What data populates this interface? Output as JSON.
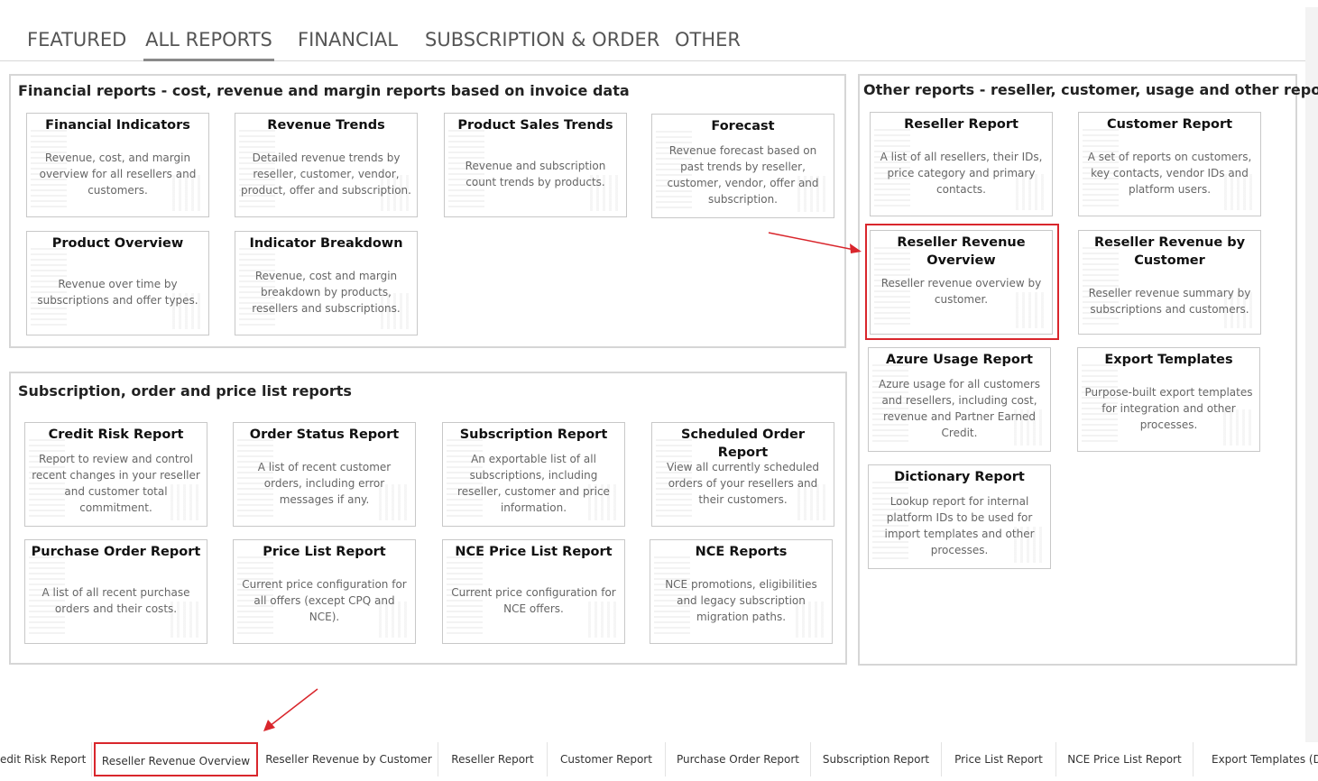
{
  "tabs": [
    {
      "label": "FEATURED"
    },
    {
      "label": "ALL REPORTS"
    },
    {
      "label": "FINANCIAL"
    },
    {
      "label": "SUBSCRIPTION & ORDER"
    },
    {
      "label": "OTHER"
    }
  ],
  "sections": {
    "financial": {
      "title": "Financial reports - cost, revenue and margin reports based on invoice data",
      "cards": [
        {
          "title": "Financial Indicators",
          "desc": "Revenue, cost, and margin overview for all resellers and customers."
        },
        {
          "title": "Revenue Trends",
          "desc": "Detailed revenue trends by reseller, customer, vendor, product, offer and subscription."
        },
        {
          "title": "Product Sales Trends",
          "desc": "Revenue and subscription count trends by products."
        },
        {
          "title": "Forecast",
          "desc": "Revenue forecast based on past trends by reseller, customer, vendor, offer and subscription."
        },
        {
          "title": "Product Overview",
          "desc": "Revenue over time by subscriptions and offer types."
        },
        {
          "title": "Indicator Breakdown",
          "desc": "Revenue, cost and margin breakdown by products, resellers and subscriptions."
        }
      ]
    },
    "subscription": {
      "title": "Subscription, order and price list reports",
      "cards": [
        {
          "title": "Credit Risk Report",
          "desc": "Report to review and control recent changes in your reseller and customer total commitment."
        },
        {
          "title": "Order Status Report",
          "desc": "A list of recent customer orders, including error messages if any."
        },
        {
          "title": "Subscription Report",
          "desc": "An exportable list of all subscriptions, including reseller, customer and price information."
        },
        {
          "title": "Scheduled Order Report",
          "desc": "View all currently scheduled orders of your resellers and their customers."
        },
        {
          "title": "Purchase Order Report",
          "desc": "A list of all recent purchase orders and their costs."
        },
        {
          "title": "Price List Report",
          "desc": "Current price configuration for all offers (except CPQ and NCE)."
        },
        {
          "title": "NCE Price List Report",
          "desc": "Current price configuration for NCE offers."
        },
        {
          "title": "NCE Reports",
          "desc": "NCE promotions, eligibilities and legacy subscription migration paths."
        }
      ]
    },
    "other": {
      "title": "Other reports - reseller, customer, usage and other reports",
      "cards": [
        {
          "title": "Reseller Report",
          "desc": "A list of all resellers, their IDs, price category and primary contacts."
        },
        {
          "title": "Customer Report",
          "desc": "A set of reports on customers, key contacts, vendor IDs and platform users."
        },
        {
          "title": "Reseller Revenue Overview",
          "desc": "Reseller revenue overview by customer."
        },
        {
          "title": "Reseller Revenue by Customer",
          "desc": "Reseller revenue summary by subscriptions and customers."
        },
        {
          "title": "Azure Usage Report",
          "desc": "Azure usage for all customers and resellers, including cost, revenue and Partner Earned Credit."
        },
        {
          "title": "Export Templates",
          "desc": "Purpose-built export templates for integration and other processes."
        },
        {
          "title": "Dictionary Report",
          "desc": "Lookup report for internal platform IDs to be used for import templates and other processes."
        }
      ]
    }
  },
  "bottom_tabs": [
    {
      "label": "edit Risk Report"
    },
    {
      "label": "Reseller Revenue Overview"
    },
    {
      "label": "Reseller Revenue by Customer"
    },
    {
      "label": "Reseller Report"
    },
    {
      "label": "Customer Report"
    },
    {
      "label": "Purchase Order Report"
    },
    {
      "label": "Subscription Report"
    },
    {
      "label": "Price List Report"
    },
    {
      "label": "NCE Price List Report"
    },
    {
      "label": "Export Templates (Dist"
    }
  ],
  "colors": {
    "highlight": "#d9262c",
    "border": "#d6d6d6"
  }
}
